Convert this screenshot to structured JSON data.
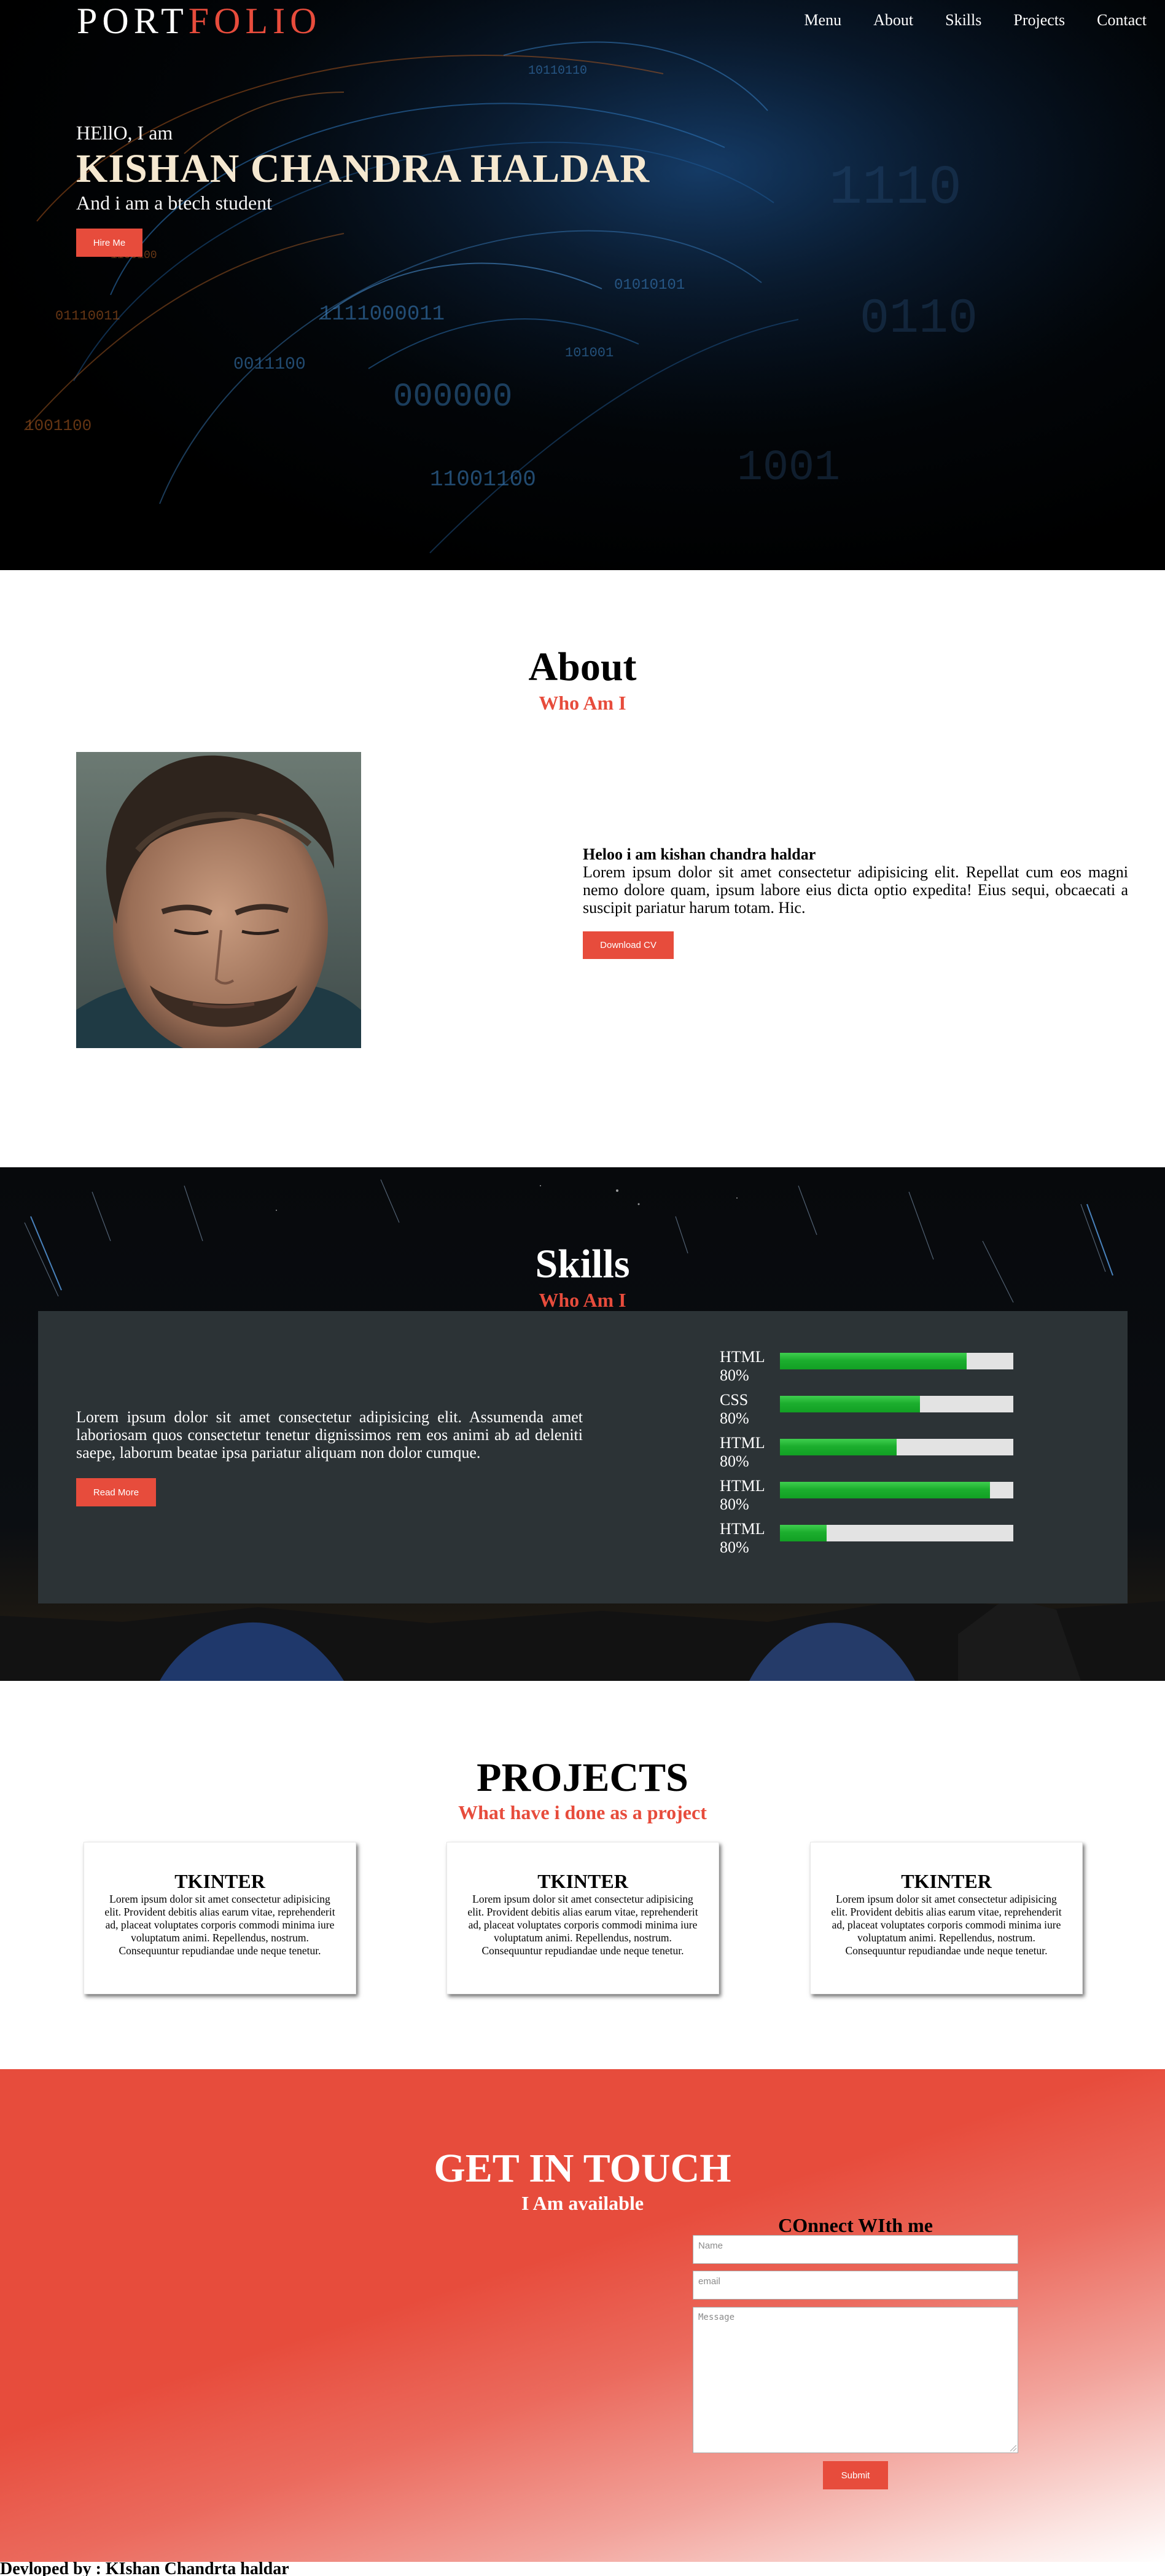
{
  "header": {
    "logo_part1": "PORT",
    "logo_part2": "FOLIO",
    "nav": [
      "Menu",
      "About",
      "Skills",
      "Projects",
      "Contact"
    ]
  },
  "hero": {
    "greeting": "HEllO, I am",
    "name": "KISHAN CHANDRA HALDAR",
    "subtitle": "And i am a btech student",
    "cta": "Hire Me"
  },
  "about": {
    "title": "About",
    "subtitle": "Who Am I",
    "heading": "Heloo i am kishan chandra haldar",
    "body": "Lorem ipsum dolor sit amet consectetur adipisicing elit. Repellat cum eos magni nemo dolore quam, ipsum labore eius dicta optio expedita! Eius sequi, obcaecati a suscipit pariatur harum totam. Hic.",
    "cta": "Download CV"
  },
  "skills": {
    "title": "Skills",
    "subtitle": "Who Am I",
    "body": "Lorem ipsum dolor sit amet consectetur adipisicing elit. Assumenda amet laboriosam quos consectetur tenetur dignissimos rem eos animi ab ad deleniti saepe, laborum beatae ipsa pariatur aliquam non dolor cumque.",
    "cta": "Read More",
    "items": [
      {
        "name": "HTML",
        "label": "80%",
        "level": 0.8
      },
      {
        "name": "CSS",
        "label": "80%",
        "level": 0.6
      },
      {
        "name": "HTML",
        "label": "80%",
        "level": 0.5
      },
      {
        "name": "HTML",
        "label": "80%",
        "level": 0.9
      },
      {
        "name": "HTML",
        "label": "80%",
        "level": 0.2
      }
    ]
  },
  "projects": {
    "title": "PROJECTS",
    "subtitle": "What have i done as a project",
    "cards": [
      {
        "title": "TKINTER",
        "body": "Lorem ipsum dolor sit amet consectetur adipisicing elit. Provident debitis alias earum vitae, reprehenderit ad, placeat voluptates corporis commodi minima iure voluptatum animi. Repellendus, nostrum. Consequuntur repudiandae unde neque tenetur."
      },
      {
        "title": "TKINTER",
        "body": "Lorem ipsum dolor sit amet consectetur adipisicing elit. Provident debitis alias earum vitae, reprehenderit ad, placeat voluptates corporis commodi minima iure voluptatum animi. Repellendus, nostrum. Consequuntur repudiandae unde neque tenetur."
      },
      {
        "title": "TKINTER",
        "body": "Lorem ipsum dolor sit amet consectetur adipisicing elit. Provident debitis alias earum vitae, reprehenderit ad, placeat voluptates corporis commodi minima iure voluptatum animi. Repellendus, nostrum. Consequuntur repudiandae unde neque tenetur."
      }
    ]
  },
  "contact": {
    "title": "GET IN TOUCH",
    "subtitle": "I Am available",
    "form_title": "COnnect WIth me",
    "name_placeholder": "Name",
    "email_placeholder": "email",
    "message_placeholder": "Message",
    "submit": "Submit"
  },
  "footer": {
    "text": "Devloped by : KIshan Chandrta haldar"
  },
  "colors": {
    "accent": "#e74c3c",
    "skills_panel": "#2c3336",
    "skill_bar": "#1cae2e"
  }
}
